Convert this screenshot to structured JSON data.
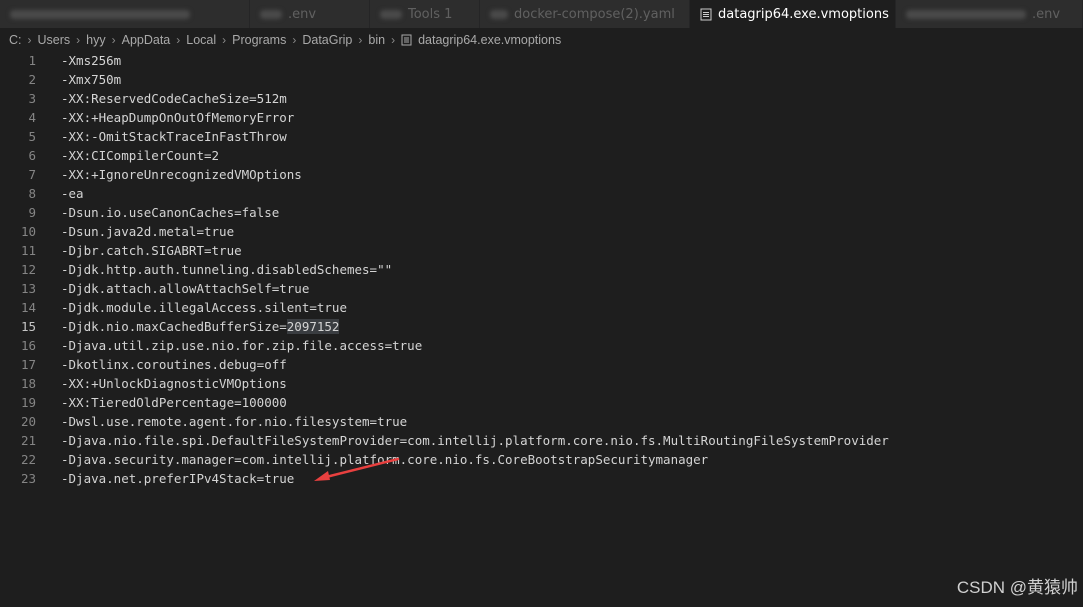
{
  "tabs": [
    {
      "label": "",
      "active": false
    },
    {
      "label": ".env",
      "active": false
    },
    {
      "label": "Tools 1",
      "active": false
    },
    {
      "label": "docker-compose(2).yaml",
      "active": false
    },
    {
      "label": "datagrip64.exe.vmoptions",
      "active": true
    },
    {
      "label": ".env",
      "active": false
    }
  ],
  "breadcrumb": {
    "items": [
      "C:",
      "Users",
      "hyy",
      "AppData",
      "Local",
      "Programs",
      "DataGrip",
      "bin",
      "datagrip64.exe.vmoptions"
    ]
  },
  "editor": {
    "current_line": 15,
    "lines": [
      {
        "num": "1",
        "text": "-Xms256m"
      },
      {
        "num": "2",
        "text": "-Xmx750m"
      },
      {
        "num": "3",
        "text": "-XX:ReservedCodeCacheSize=512m"
      },
      {
        "num": "4",
        "text": "-XX:+HeapDumpOnOutOfMemoryError"
      },
      {
        "num": "5",
        "text": "-XX:-OmitStackTraceInFastThrow"
      },
      {
        "num": "6",
        "text": "-XX:CICompilerCount=2"
      },
      {
        "num": "7",
        "text": "-XX:+IgnoreUnrecognizedVMOptions"
      },
      {
        "num": "8",
        "text": "-ea"
      },
      {
        "num": "9",
        "text": "-Dsun.io.useCanonCaches=false"
      },
      {
        "num": "10",
        "text": "-Dsun.java2d.metal=true"
      },
      {
        "num": "11",
        "text": "-Djbr.catch.SIGABRT=true"
      },
      {
        "num": "12",
        "text": "-Djdk.http.auth.tunneling.disabledSchemes=\"\""
      },
      {
        "num": "13",
        "text": "-Djdk.attach.allowAttachSelf=true"
      },
      {
        "num": "14",
        "text": "-Djdk.module.illegalAccess.silent=true"
      },
      {
        "num": "15",
        "text": "-Djdk.nio.maxCachedBufferSize=",
        "highlight": "2097152"
      },
      {
        "num": "16",
        "text": "-Djava.util.zip.use.nio.for.zip.file.access=true"
      },
      {
        "num": "17",
        "text": "-Dkotlinx.coroutines.debug=off"
      },
      {
        "num": "18",
        "text": "-XX:+UnlockDiagnosticVMOptions"
      },
      {
        "num": "19",
        "text": "-XX:TieredOldPercentage=100000"
      },
      {
        "num": "20",
        "text": "-Dwsl.use.remote.agent.for.nio.filesystem=true"
      },
      {
        "num": "21",
        "text": "-Djava.nio.file.spi.DefaultFileSystemProvider=com.intellij.platform.core.nio.fs.MultiRoutingFileSystemProvider"
      },
      {
        "num": "22",
        "text": "-Djava.security.manager=com.intellij.platform.core.nio.fs.CoreBootstrapSecuritymanager"
      },
      {
        "num": "23",
        "text": "-Djava.net.preferIPv4Stack=true"
      }
    ]
  },
  "watermark": "CSDN @黄猿帅",
  "colors": {
    "background": "#1e1e1e",
    "annotation_arrow": "#e8403f"
  },
  "icons": [
    "file-icon",
    "close-icon",
    "chevron-right-icon"
  ]
}
